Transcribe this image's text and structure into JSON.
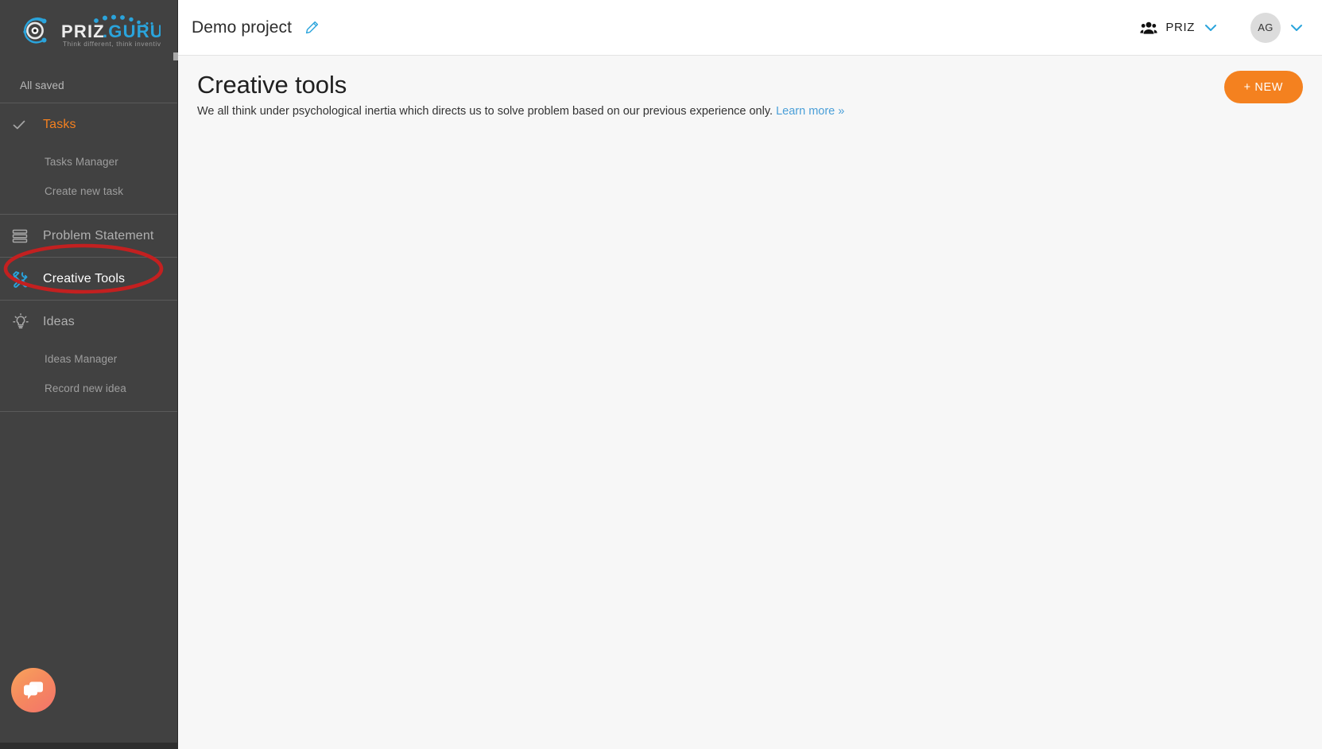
{
  "brand": {
    "name_dark": "PRIZ",
    "name_dot": ".",
    "name_light": "GURU",
    "tagline": "Think different, think inventive...",
    "accent_color": "#2aa4dc",
    "logo_icon": "priz-guru-logo-icon"
  },
  "sidebar": {
    "save_status": "All saved",
    "sections": [
      {
        "id": "tasks",
        "label": "Tasks",
        "icon": "check-icon",
        "state": "accent",
        "children": [
          {
            "label": "Tasks Manager"
          },
          {
            "label": "Create new task"
          }
        ]
      },
      {
        "id": "problem-statement",
        "label": "Problem Statement",
        "icon": "stacked-lines-icon",
        "state": "normal",
        "children": []
      },
      {
        "id": "creative-tools",
        "label": "Creative Tools",
        "icon": "tools-icon",
        "state": "active",
        "children": []
      },
      {
        "id": "ideas",
        "label": "Ideas",
        "icon": "lightbulb-icon",
        "state": "normal",
        "children": [
          {
            "label": "Ideas Manager"
          },
          {
            "label": "Record new idea"
          }
        ]
      }
    ],
    "chat_widget": {
      "icon": "chat-bubbles-icon",
      "gradient_from": "#f9a45c",
      "gradient_to": "#f4736b"
    }
  },
  "annotation": {
    "shape": "ellipse",
    "color": "#c32020",
    "targets": "creative-tools"
  },
  "header": {
    "project_title": "Demo project",
    "edit_icon": "pencil-icon",
    "team": {
      "icon": "people-group-icon",
      "label": "PRIZ",
      "chevron": "chevron-down-icon"
    },
    "account": {
      "initials": "AG",
      "chevron": "chevron-down-icon"
    }
  },
  "main": {
    "title": "Creative tools",
    "subtitle": "We all think under psychological inertia which directs us to solve problem based on our previous experience only.",
    "learn_more": "Learn more »",
    "new_button": "+ NEW",
    "new_button_color": "#f4811f"
  }
}
